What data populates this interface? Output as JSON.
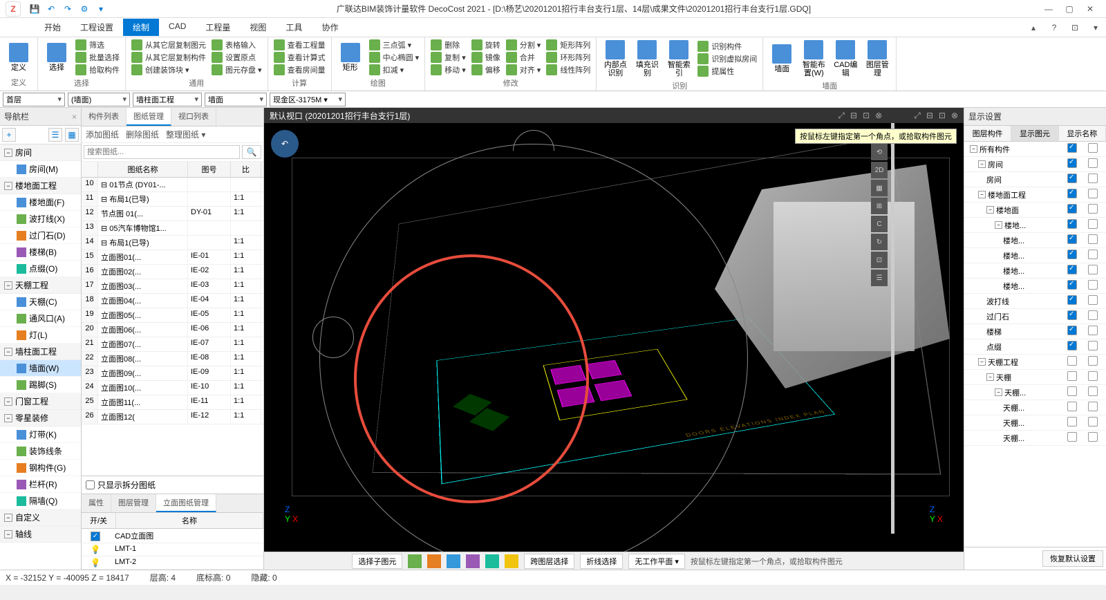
{
  "titlebar": {
    "title": "广联达BIM装饰计量软件 DecoCost 2021 - [D:\\杨艺\\20201201招行丰台支行1层、14层\\成果文件\\20201201招行丰台支行1层.GDQ]"
  },
  "menu": {
    "items": [
      "开始",
      "工程设置",
      "绘制",
      "CAD",
      "工程量",
      "视图",
      "工具",
      "协作"
    ],
    "active_index": 2
  },
  "ribbon": {
    "groups": [
      {
        "label": "定义",
        "big": [
          "定义"
        ]
      },
      {
        "label": "选择",
        "big": [
          "选择"
        ],
        "small": [
          "筛选",
          "批量选择",
          "拾取构件"
        ]
      },
      {
        "label": "通用",
        "small": [
          "从其它层复制图元",
          "从其它层复制构件",
          "创建装饰块 ▾",
          "表格输入",
          "设置原点",
          "图元存盘 ▾"
        ]
      },
      {
        "label": "计算",
        "small": [
          "查看工程量",
          "查看计算式",
          "查看房间量"
        ]
      },
      {
        "label": "绘图",
        "big": [
          "矩形"
        ],
        "small": [
          "三点弧 ▾",
          "中心椭圆 ▾",
          "扣减 ▾"
        ]
      },
      {
        "label": "修改",
        "small": [
          "删除",
          "复制 ▾",
          "移动 ▾",
          "旋转",
          "镜像",
          "偏移",
          "分割 ▾",
          "合并",
          "对齐 ▾",
          "矩形阵列",
          "环形阵列",
          "线性阵列"
        ]
      },
      {
        "label": "识别",
        "big": [
          "内部点识别",
          "填充识别",
          "智能索引"
        ],
        "small": [
          "识别构件",
          "识别虚拟房间",
          "提属性"
        ]
      },
      {
        "label": "墙面",
        "big": [
          "墙面",
          "智能布置(W)",
          "CAD编辑",
          "图层管理"
        ]
      }
    ]
  },
  "filters": {
    "combo1": "首层",
    "combo2": "(墙面)",
    "combo3": "墙柱面工程",
    "combo4": "墙面",
    "combo5": "现金区-3175M ▾"
  },
  "nav": {
    "title": "导航栏",
    "groups": [
      {
        "name": "房间",
        "items": [
          "房间(M)"
        ]
      },
      {
        "name": "楼地面工程",
        "items": [
          "楼地面(F)",
          "波打线(X)",
          "过门石(D)",
          "楼梯(B)",
          "点缀(O)"
        ]
      },
      {
        "name": "天棚工程",
        "items": [
          "天棚(C)",
          "通风口(A)",
          "灯(L)"
        ]
      },
      {
        "name": "墙柱面工程",
        "items": [
          "墙面(W)",
          "踢脚(S)"
        ],
        "selected": 0
      },
      {
        "name": "门窗工程",
        "items": []
      },
      {
        "name": "零星装修",
        "items": [
          "灯带(K)",
          "装饰线条",
          "钢构件(G)",
          "栏杆(R)",
          "隔墙(Q)"
        ]
      },
      {
        "name": "自定义",
        "items": []
      },
      {
        "name": "轴线",
        "items": []
      }
    ]
  },
  "mid": {
    "tabs": [
      "构件列表",
      "图纸管理",
      "视口列表"
    ],
    "active_tab": 1,
    "toolbar": [
      "添加图纸",
      "删除图纸",
      "整理图纸 ▾"
    ],
    "search_placeholder": "搜索图纸...",
    "headers": [
      "图纸名称",
      "图号",
      "比"
    ],
    "rows": [
      {
        "n": "10",
        "name": "⊟ 01节点 (DY01-...",
        "code": "",
        "ratio": ""
      },
      {
        "n": "11",
        "name": "⊟ 布局1(已导)",
        "code": "",
        "ratio": "1:1"
      },
      {
        "n": "12",
        "name": "  节点图 01(...",
        "code": "DY-01",
        "ratio": "1:1"
      },
      {
        "n": "13",
        "name": "⊟ 05汽车博物馆1...",
        "code": "",
        "ratio": ""
      },
      {
        "n": "14",
        "name": "⊟ 布局1(已导)",
        "code": "",
        "ratio": "1:1"
      },
      {
        "n": "15",
        "name": "  立面图01(...",
        "code": "IE-01",
        "ratio": "1:1"
      },
      {
        "n": "16",
        "name": "  立面图02(...",
        "code": "IE-02",
        "ratio": "1:1"
      },
      {
        "n": "17",
        "name": "  立面图03(...",
        "code": "IE-03",
        "ratio": "1:1"
      },
      {
        "n": "18",
        "name": "  立面图04(...",
        "code": "IE-04",
        "ratio": "1:1"
      },
      {
        "n": "19",
        "name": "  立面图05(...",
        "code": "IE-05",
        "ratio": "1:1"
      },
      {
        "n": "20",
        "name": "  立面图06(...",
        "code": "IE-06",
        "ratio": "1:1"
      },
      {
        "n": "21",
        "name": "  立面图07(...",
        "code": "IE-07",
        "ratio": "1:1"
      },
      {
        "n": "22",
        "name": "  立面图08(...",
        "code": "IE-08",
        "ratio": "1:1"
      },
      {
        "n": "23",
        "name": "  立面图09(...",
        "code": "IE-09",
        "ratio": "1:1"
      },
      {
        "n": "24",
        "name": "  立面图10(...",
        "code": "IE-10",
        "ratio": "1:1"
      },
      {
        "n": "25",
        "name": "  立面图11(...",
        "code": "IE-11",
        "ratio": "1:1"
      },
      {
        "n": "26",
        "name": "  立面图12(",
        "code": "IE-12",
        "ratio": "1:1"
      }
    ],
    "check_label": "只显示拆分图纸",
    "prop_tabs": [
      "属性",
      "图层管理",
      "立面图纸管理"
    ],
    "prop_active": 2,
    "prop_headers": [
      "开/关",
      "名称"
    ],
    "prop_rows": [
      {
        "type": "check",
        "name": "CAD立面图"
      },
      {
        "type": "bulb",
        "name": "LMT-1"
      },
      {
        "type": "bulb",
        "name": "LMT-2"
      }
    ]
  },
  "viewport": {
    "title": "默认视口 (20201201招行丰台支行1层)",
    "tooltip": "按鼠标左键指定第一个角点，或拾取构件图元",
    "axis": {
      "x": "X",
      "y": "Y",
      "z": "Z"
    },
    "bottom": {
      "btn1": "选择子图元",
      "btn2": "跨图层选择",
      "btn3": "折线选择",
      "btn4": "无工作平面 ▾",
      "hint": "按鼠标左键指定第一个角点，或拾取构件图元"
    },
    "toolbar_items": [
      "⟲",
      "2D",
      "▦",
      "⊞",
      "C",
      "↻",
      "⊡",
      "☰"
    ]
  },
  "display": {
    "title": "显示设置",
    "headers": [
      "图层构件",
      "显示图元",
      "显示名称"
    ],
    "active_header": 1,
    "rows": [
      {
        "indent": 0,
        "tgl": "−",
        "name": "所有构件",
        "c1": true,
        "c2": false
      },
      {
        "indent": 1,
        "tgl": "−",
        "name": "房间",
        "c1": true,
        "c2": false
      },
      {
        "indent": 2,
        "tgl": "",
        "name": "房间",
        "c1": true,
        "c2": false
      },
      {
        "indent": 1,
        "tgl": "−",
        "name": "楼地面工程",
        "c1": true,
        "c2": false
      },
      {
        "indent": 2,
        "tgl": "−",
        "name": "楼地面",
        "c1": true,
        "c2": false
      },
      {
        "indent": 3,
        "tgl": "−",
        "name": "楼地...",
        "c1": true,
        "c2": false
      },
      {
        "indent": 4,
        "tgl": "",
        "name": "楼地...",
        "c1": true,
        "c2": false
      },
      {
        "indent": 4,
        "tgl": "",
        "name": "楼地...",
        "c1": true,
        "c2": false
      },
      {
        "indent": 4,
        "tgl": "",
        "name": "楼地...",
        "c1": true,
        "c2": false
      },
      {
        "indent": 4,
        "tgl": "",
        "name": "楼地...",
        "c1": true,
        "c2": false
      },
      {
        "indent": 2,
        "tgl": "",
        "name": "波打线",
        "c1": true,
        "c2": false
      },
      {
        "indent": 2,
        "tgl": "",
        "name": "过门石",
        "c1": true,
        "c2": false
      },
      {
        "indent": 2,
        "tgl": "",
        "name": "楼梯",
        "c1": true,
        "c2": false
      },
      {
        "indent": 2,
        "tgl": "",
        "name": "点缀",
        "c1": true,
        "c2": false
      },
      {
        "indent": 1,
        "tgl": "−",
        "name": "天棚工程",
        "c1": false,
        "c2": false
      },
      {
        "indent": 2,
        "tgl": "−",
        "name": "天棚",
        "c1": false,
        "c2": false
      },
      {
        "indent": 3,
        "tgl": "−",
        "name": "天棚...",
        "c1": false,
        "c2": false
      },
      {
        "indent": 4,
        "tgl": "",
        "name": "天棚...",
        "c1": false,
        "c2": false
      },
      {
        "indent": 4,
        "tgl": "",
        "name": "天棚...",
        "c1": false,
        "c2": false
      },
      {
        "indent": 4,
        "tgl": "",
        "name": "天棚...",
        "c1": false,
        "c2": false
      }
    ],
    "reset": "恢复默认设置"
  },
  "status": {
    "coords": "X = -32152 Y = -40095 Z = 18417",
    "floor_h": "层高: 4",
    "bottom_h": "底标高: 0",
    "hidden": "隐藏: 0"
  }
}
